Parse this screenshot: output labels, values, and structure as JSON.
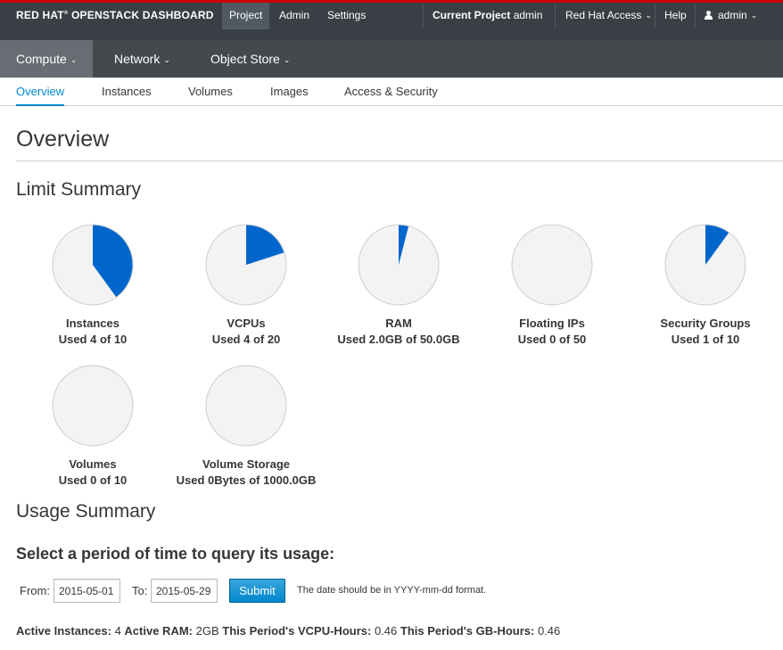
{
  "brand": {
    "name": "RED HAT",
    "mark": "®",
    "product": "OPENSTACK DASHBOARD"
  },
  "topnav": {
    "items": [
      {
        "label": "Project",
        "active": true
      },
      {
        "label": "Admin",
        "active": false
      },
      {
        "label": "Settings",
        "active": false
      }
    ],
    "current_project_label": "Current Project",
    "current_project_value": "admin",
    "red_hat_access": "Red Hat Access",
    "help": "Help",
    "user": "admin"
  },
  "secondary_nav": [
    {
      "label": "Compute",
      "active": true
    },
    {
      "label": "Network",
      "active": false
    },
    {
      "label": "Object Store",
      "active": false
    }
  ],
  "tabs": [
    {
      "label": "Overview",
      "active": true
    },
    {
      "label": "Instances",
      "active": false
    },
    {
      "label": "Volumes",
      "active": false
    },
    {
      "label": "Images",
      "active": false
    },
    {
      "label": "Access & Security",
      "active": false
    }
  ],
  "page_title": "Overview",
  "limit_summary": {
    "title": "Limit Summary",
    "colors": {
      "used": "#0066cc",
      "free": "#f3f3f3",
      "border": "#cccccc"
    },
    "pies": [
      {
        "label": "Instances",
        "usage": "Used 4 of 10",
        "used": 4,
        "total": 10
      },
      {
        "label": "VCPUs",
        "usage": "Used 4 of 20",
        "used": 4,
        "total": 20
      },
      {
        "label": "RAM",
        "usage": "Used 2.0GB of 50.0GB",
        "used": 2.0,
        "total": 50.0
      },
      {
        "label": "Floating IPs",
        "usage": "Used 0 of 50",
        "used": 0,
        "total": 50
      },
      {
        "label": "Security Groups",
        "usage": "Used 1 of 10",
        "used": 1,
        "total": 10
      },
      {
        "label": "Volumes",
        "usage": "Used 0 of 10",
        "used": 0,
        "total": 10
      },
      {
        "label": "Volume Storage",
        "usage": "Used 0Bytes of 1000.0GB",
        "used": 0,
        "total": 1000.0
      }
    ]
  },
  "usage_summary": {
    "title": "Usage Summary",
    "query_heading": "Select a period of time to query its usage:",
    "from_label": "From:",
    "from_value": "2015-05-01",
    "to_label": "To:",
    "to_value": "2015-05-29",
    "submit_label": "Submit",
    "hint": "The date should be in YYYY-mm-dd format.",
    "stats": [
      {
        "label": "Active Instances:",
        "value": "4"
      },
      {
        "label": "Active RAM:",
        "value": "2GB"
      },
      {
        "label": "This Period's VCPU-Hours:",
        "value": "0.46"
      },
      {
        "label": "This Period's GB-Hours:",
        "value": "0.46"
      }
    ]
  }
}
